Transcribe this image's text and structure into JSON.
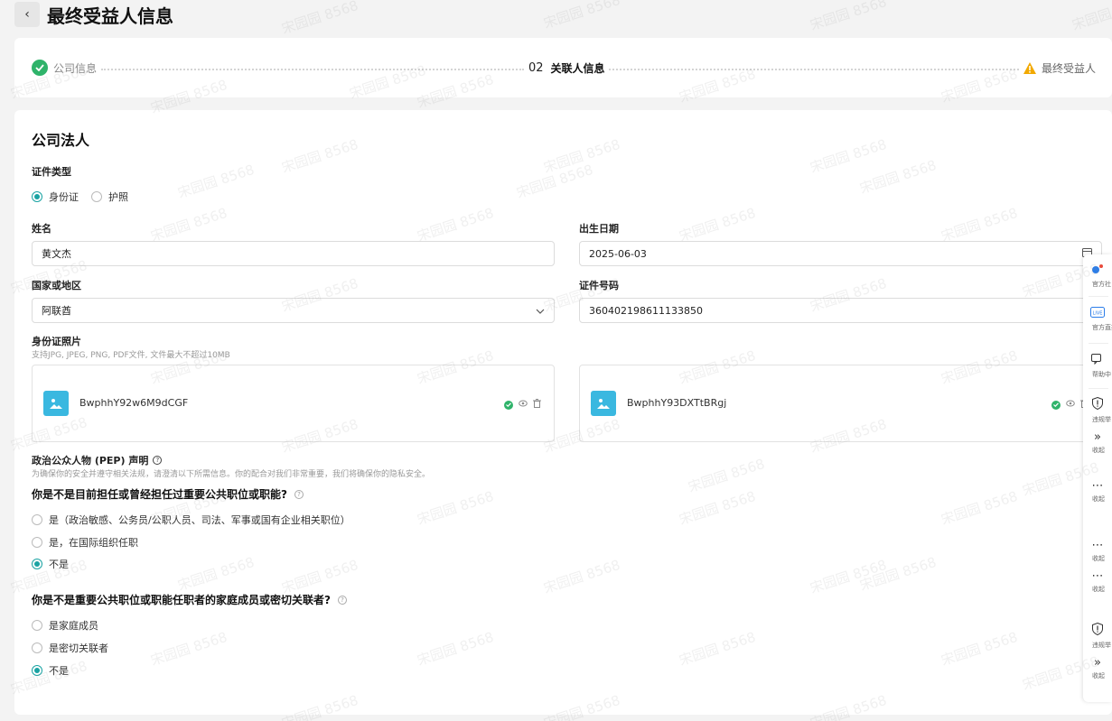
{
  "header": {
    "back_icon": "‹",
    "title": "最终受益人信息"
  },
  "steps": {
    "step1": {
      "label": "公司信息",
      "status": "done"
    },
    "step2": {
      "number": "02",
      "label": "关联人信息",
      "status": "current"
    },
    "step3": {
      "label": "最终受益人",
      "status": "warning"
    }
  },
  "form": {
    "section_title": "公司法人",
    "id_type": {
      "label": "证件类型",
      "options": [
        "身份证",
        "护照"
      ],
      "selected": "身份证"
    },
    "name": {
      "label": "姓名",
      "value": "黄文杰"
    },
    "birth_date": {
      "label": "出生日期",
      "value": "2025-06-03",
      "icon": "calendar-icon"
    },
    "country": {
      "label": "国家或地区",
      "value": "阿联酋",
      "icon": "chevron-down-icon"
    },
    "id_number": {
      "label": "证件号码",
      "value": "360402198611133850"
    },
    "id_photo": {
      "label": "身份证照片",
      "hint": "支持JPG, JPEG, PNG, PDF文件, 文件最大不超过10MB",
      "files": [
        {
          "name": "BwphhY92w6M9dCGF"
        },
        {
          "name": "BwphhY93DXTtBRgj"
        }
      ]
    },
    "pep": {
      "label": "政治公众人物 (PEP) 声明",
      "hint": "为确保你的安全并遵守相关法规，请澄清以下所需信息。你的配合对我们非常重要，我们将确保你的隐私安全。",
      "q1": {
        "text": "你是不是目前担任或曾经担任过重要公共职位或职能?",
        "options": [
          "是（政治敏感、公务员/公职人员、司法、军事或国有企业相关职位）",
          "是，在国际组织任职",
          "不是"
        ],
        "selected": "不是"
      },
      "q2": {
        "text": "你是不是重要公共职位或职能任职者的家庭成员或密切关联者?",
        "options": [
          "是家庭成员",
          "是密切关联者",
          "不是"
        ],
        "selected": "不是"
      }
    }
  },
  "side_panel": {
    "items": [
      {
        "label": "官方社",
        "icon": "social-icon"
      },
      {
        "label": "官方直播",
        "icon": "live-icon"
      },
      {
        "label": "帮助中",
        "icon": "chat-icon"
      },
      {
        "label": "违规举",
        "icon": "shield-icon"
      },
      {
        "label": "收起",
        "icon": "collapse-icon"
      },
      {
        "label": "收起",
        "icon": "more-icon"
      },
      {
        "label": "收起",
        "icon": "more-icon"
      },
      {
        "label": "收起",
        "icon": "more-icon"
      },
      {
        "label": "违规举",
        "icon": "shield-icon"
      },
      {
        "label": "收起",
        "icon": "collapse-icon"
      }
    ]
  },
  "watermark": {
    "text": "宋园园 8568"
  },
  "colors": {
    "accent": "#1aa3a3",
    "success": "#2fb36a",
    "warning": "#f2a900",
    "file_thumb": "#3ab8e0"
  }
}
